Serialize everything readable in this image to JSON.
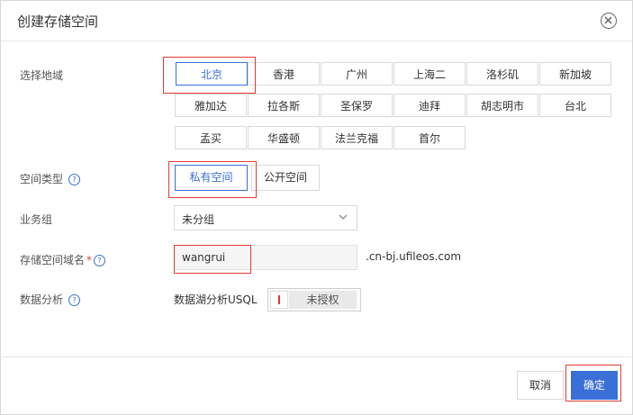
{
  "dialog": {
    "title": "创建存储空间"
  },
  "region": {
    "label": "选择地域",
    "options": [
      "北京",
      "香港",
      "广州",
      "上海二",
      "洛杉矶",
      "新加坡",
      "雅加达",
      "拉各斯",
      "圣保罗",
      "迪拜",
      "胡志明市",
      "台北",
      "孟买",
      "华盛顿",
      "法兰克福",
      "首尔"
    ],
    "selected": "北京"
  },
  "space_type": {
    "label": "空间类型",
    "private": "私有空间",
    "public": "公开空间",
    "selected": "私有空间"
  },
  "business_group": {
    "label": "业务组",
    "value": "未分组"
  },
  "bucket_name": {
    "label": "存储空间域名",
    "required_mark": "*",
    "value": "wangrui",
    "suffix": ".cn-bj.ufileos.com"
  },
  "data_analysis": {
    "label": "数据分析",
    "feature": "数据湖分析USQL",
    "toggle_text": "未授权"
  },
  "footer": {
    "cancel": "取消",
    "confirm": "确定"
  },
  "colors": {
    "accent": "#3b6fd8",
    "highlight": "#e53935"
  }
}
